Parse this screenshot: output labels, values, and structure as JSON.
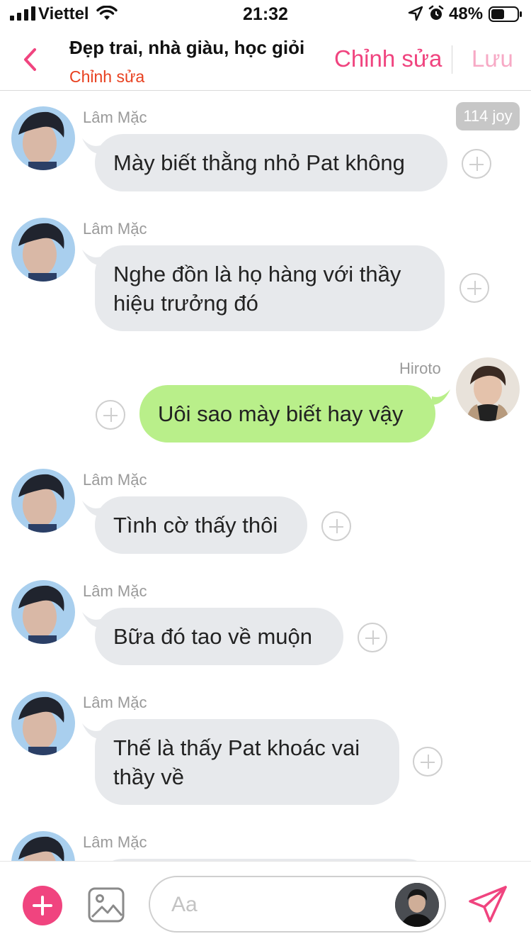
{
  "status_bar": {
    "carrier": "Viettel",
    "time": "21:32",
    "battery_percent": "48%"
  },
  "header": {
    "title": "Đẹp trai, nhà giàu, học giỏi",
    "subtitle": "Chỉnh sửa",
    "edit_label": "Chỉnh sửa",
    "save_label": "Lưu"
  },
  "joy_badge": "114 joy",
  "messages": [
    {
      "sender": "Lâm Mặc",
      "text": "Mày biết thằng nhỏ Pat không",
      "direction": "incoming"
    },
    {
      "sender": "Lâm Mặc",
      "text": "Nghe đồn là họ hàng với thầy hiệu trưởng đó",
      "direction": "incoming"
    },
    {
      "sender": "Hiroto",
      "text": "Uôi sao mày biết hay vậy",
      "direction": "outgoing"
    },
    {
      "sender": "Lâm Mặc",
      "text": "Tình cờ thấy thôi",
      "direction": "incoming"
    },
    {
      "sender": "Lâm Mặc",
      "text": "Bữa đó tao về muộn",
      "direction": "incoming"
    },
    {
      "sender": "Lâm Mặc",
      "text": "Thế là thấy Pat khoác vai thầy về",
      "direction": "incoming"
    },
    {
      "sender": "Lâm Mặc",
      "text": "",
      "direction": "incoming"
    }
  ],
  "composer": {
    "placeholder": "Aa"
  },
  "colors": {
    "accent": "#f0447f",
    "accent_light": "#f7a9c5",
    "subtitle_red": "#e8401f",
    "incoming_bubble": "#e7e9ec",
    "outgoing_bubble": "#b9ef8a"
  },
  "icons": {
    "back": "chevron-left-icon",
    "add": "plus-circle-icon",
    "image": "image-icon",
    "send": "paper-plane-icon",
    "reaction": "plus-outline-icon"
  }
}
